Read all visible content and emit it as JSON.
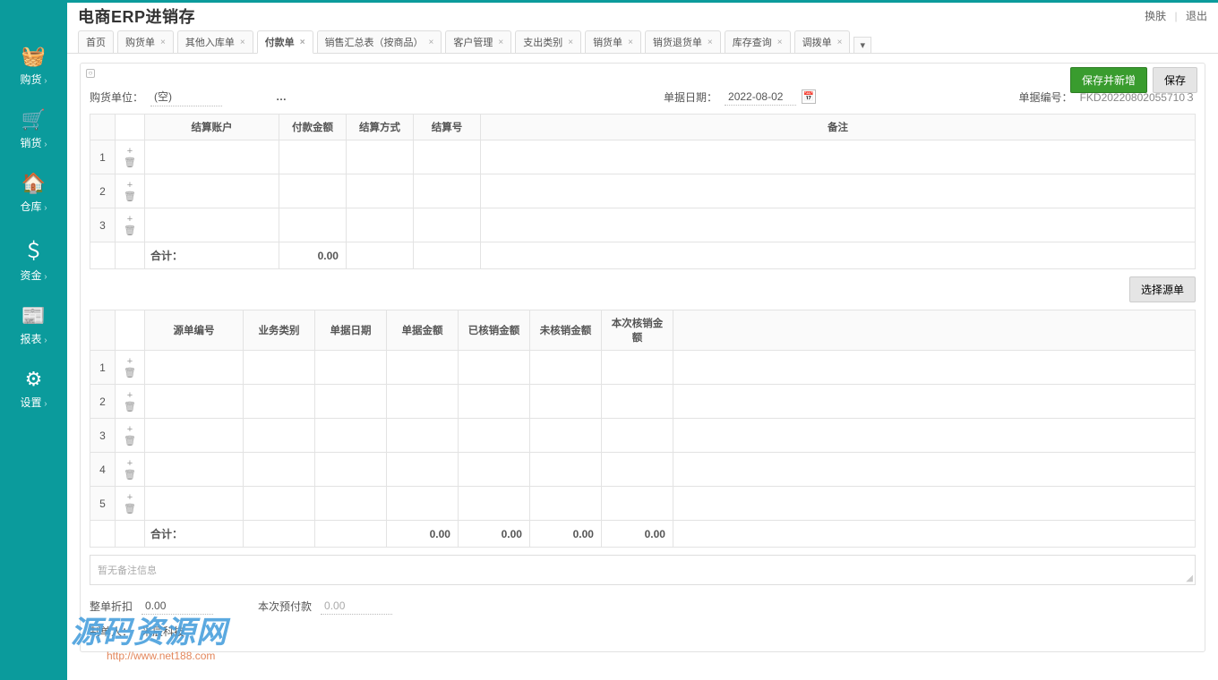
{
  "app_title": "电商ERP进销存",
  "top_right": {
    "switch": "换肤",
    "logout": "退出"
  },
  "sidebar": [
    {
      "name": "purchase",
      "icon": "🧺",
      "label": "购货"
    },
    {
      "name": "sales",
      "icon": "🛒",
      "label": "销货"
    },
    {
      "name": "warehouse",
      "icon": "🏠",
      "label": "仓库"
    },
    {
      "name": "funds",
      "icon": "＄",
      "label": "资金"
    },
    {
      "name": "reports",
      "icon": "📰",
      "label": "报表"
    },
    {
      "name": "settings",
      "icon": "⚙",
      "label": "设置"
    }
  ],
  "tabs": [
    {
      "label": "首页",
      "closable": false
    },
    {
      "label": "购货单",
      "closable": true
    },
    {
      "label": "其他入库单",
      "closable": true
    },
    {
      "label": "付款单",
      "closable": true,
      "active": true
    },
    {
      "label": "销售汇总表（按商品）",
      "closable": true
    },
    {
      "label": "客户管理",
      "closable": true
    },
    {
      "label": "支出类别",
      "closable": true
    },
    {
      "label": "销货单",
      "closable": true
    },
    {
      "label": "销货退货单",
      "closable": true
    },
    {
      "label": "库存查询",
      "closable": true
    },
    {
      "label": "调拨单",
      "closable": true
    }
  ],
  "actions": {
    "save_new": "保存并新增",
    "save": "保存"
  },
  "form": {
    "supplier_label": "购货单位：",
    "supplier_value": "(空)",
    "date_label": "单据日期：",
    "date_value": "2022-08-02",
    "docno_label": "单据编号：",
    "docno_value": "FKD20220802055710３"
  },
  "table1": {
    "headers": [
      "结算账户",
      "付款金额",
      "结算方式",
      "结算号",
      "备注"
    ],
    "rows": 3,
    "sum_label": "合计：",
    "sum_amount": "0.00"
  },
  "select_source": "选择源单",
  "table2": {
    "headers": [
      "源单编号",
      "业务类别",
      "单据日期",
      "单据金额",
      "已核销金额",
      "未核销金额",
      "本次核销金额"
    ],
    "rows": 5,
    "sum_label": "合计：",
    "sums": [
      "0.00",
      "0.00",
      "0.00",
      "0.00"
    ]
  },
  "remark_placeholder": "暂无备注信息",
  "bottom": {
    "discount_label": "整单折扣",
    "discount_value": "0.00",
    "prepay_label": "本次预付款",
    "prepay_value": "0.00",
    "creator_label": "制单人：",
    "creator_value": "米辰科技"
  },
  "watermark": {
    "big": "源码资源网",
    "small": "http://www.net188.com"
  }
}
